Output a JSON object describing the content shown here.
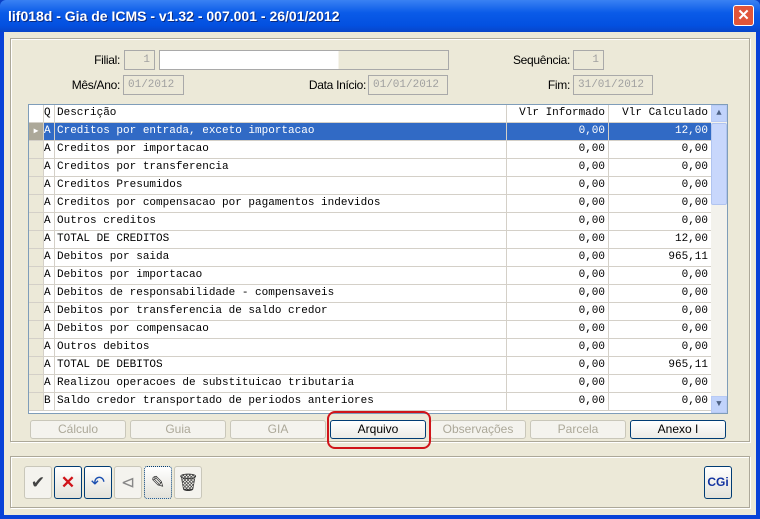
{
  "window": {
    "title": "lif018d - Gia de ICMS - v1.32 - 007.001 - 26/01/2012",
    "close_icon": "close-icon"
  },
  "form": {
    "filial_label": "Filial:",
    "filial_value": "1",
    "filial_name": "",
    "sequencia_label": "Sequência:",
    "sequencia_value": "1",
    "mesano_label": "Mês/Ano:",
    "mesano_value": "01/2012",
    "datainicio_label": "Data Início:",
    "datainicio_value": "01/01/2012",
    "fim_label": "Fim:",
    "fim_value": "31/01/2012"
  },
  "grid": {
    "headers": [
      "Q",
      "Descrição",
      "Vlr Informado",
      "Vlr Calculado"
    ],
    "rows": [
      [
        "A",
        "Creditos por entrada, exceto importacao",
        "0,00",
        "12,00"
      ],
      [
        "A",
        "Creditos por importacao",
        "0,00",
        "0,00"
      ],
      [
        "A",
        "Creditos por transferencia",
        "0,00",
        "0,00"
      ],
      [
        "A",
        "Creditos Presumidos",
        "0,00",
        "0,00"
      ],
      [
        "A",
        "Creditos por compensacao por pagamentos indevidos",
        "0,00",
        "0,00"
      ],
      [
        "A",
        "Outros creditos",
        "0,00",
        "0,00"
      ],
      [
        "A",
        "TOTAL DE CREDITOS",
        "0,00",
        "12,00"
      ],
      [
        "A",
        "Debitos por saida",
        "0,00",
        "965,11"
      ],
      [
        "A",
        "Debitos por importacao",
        "0,00",
        "0,00"
      ],
      [
        "A",
        "Debitos de responsabilidade - compensaveis",
        "0,00",
        "0,00"
      ],
      [
        "A",
        "Debitos por transferencia de saldo credor",
        "0,00",
        "0,00"
      ],
      [
        "A",
        "Debitos por compensacao",
        "0,00",
        "0,00"
      ],
      [
        "A",
        "Outros debitos",
        "0,00",
        "0,00"
      ],
      [
        "A",
        "TOTAL DE DEBITOS",
        "0,00",
        "965,11"
      ],
      [
        "A",
        "Realizou operacoes de substituicao tributaria",
        "0,00",
        "0,00"
      ],
      [
        "B",
        "Saldo credor transportado de periodos anteriores",
        "0,00",
        "0,00"
      ]
    ],
    "selected_row": 0
  },
  "tabs": [
    {
      "label": "Cálculo",
      "enabled": false
    },
    {
      "label": "Guia",
      "enabled": false
    },
    {
      "label": "GIA",
      "enabled": false
    },
    {
      "label": "Arquivo",
      "enabled": true,
      "highlighted": true
    },
    {
      "label": "Observações",
      "enabled": false
    },
    {
      "label": "Parcela",
      "enabled": false
    },
    {
      "label": "Anexo I",
      "enabled": true
    }
  ],
  "toolbar": {
    "items": [
      "check-icon",
      "cancel-icon",
      "undo-icon",
      "filter-icon",
      "edit-icon",
      "trash-icon"
    ],
    "logo": "CGi"
  },
  "colors": {
    "selection": "#316AC5",
    "highlight": "#D0141A",
    "titlebar": "#0350E0"
  }
}
